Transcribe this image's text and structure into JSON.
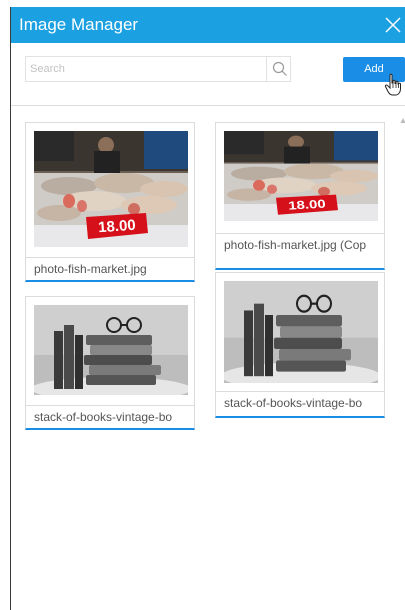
{
  "window": {
    "title": "Image Manager"
  },
  "toolbar": {
    "search_placeholder": "Search",
    "add_label": "Add"
  },
  "images": [
    {
      "filename": "photo-fish-market.jpg",
      "price_tag": "18.00"
    },
    {
      "filename": "photo-fish-market.jpg (Cop",
      "price_tag": "18.00"
    },
    {
      "filename": "stack-of-books-vintage-bo"
    },
    {
      "filename": "stack-of-books-vintage-bo"
    }
  ],
  "colors": {
    "accent": "#1ba0e2",
    "button": "#1a8ee6"
  }
}
